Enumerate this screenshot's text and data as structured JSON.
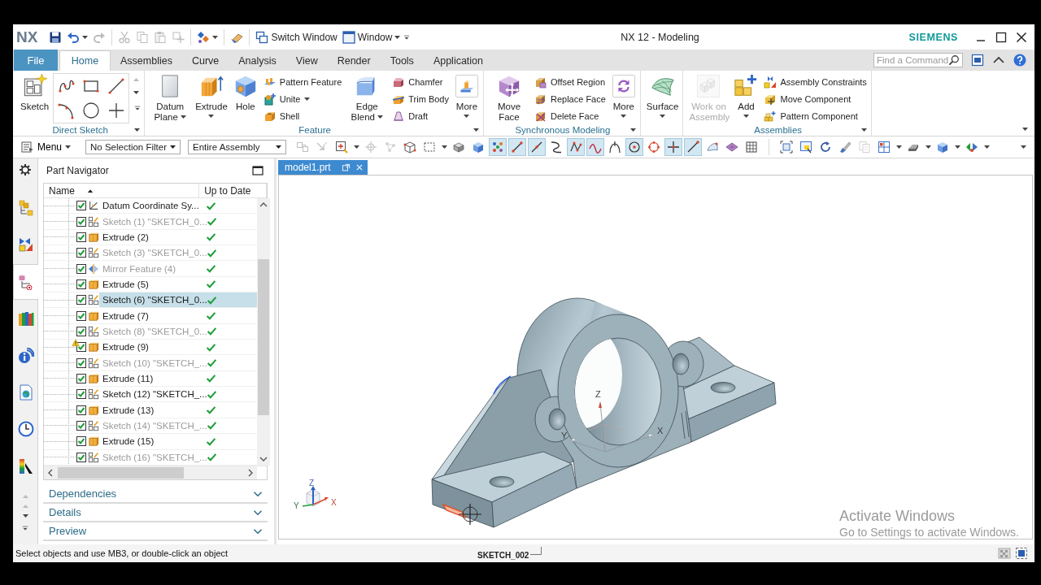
{
  "window": {
    "logo": "NX",
    "title": "NX 12 - Modeling",
    "brand": "SIEMENS"
  },
  "quick_access": {
    "tools": [
      {
        "disabled": false,
        "dropdown": false
      },
      {
        "disabled": false,
        "dropdown": true
      },
      {
        "disabled": true,
        "dropdown": false
      },
      {
        "disabled": true,
        "dropdown": false
      },
      {
        "disabled": true,
        "dropdown": false
      },
      {
        "disabled": true,
        "dropdown": false
      },
      {
        "disabled": true,
        "dropdown": false
      },
      {
        "disabled": false,
        "dropdown": true
      },
      {
        "disabled": false,
        "dropdown": false
      }
    ],
    "switch_window": "Switch Window",
    "window_menu": "Window"
  },
  "file_tab": "File",
  "tabs": [
    {
      "label": "Home",
      "selected": true
    },
    {
      "label": "Assemblies",
      "selected": false
    },
    {
      "label": "Curve",
      "selected": false
    },
    {
      "label": "Analysis",
      "selected": false
    },
    {
      "label": "View",
      "selected": false
    },
    {
      "label": "Render",
      "selected": false
    },
    {
      "label": "Tools",
      "selected": false
    },
    {
      "label": "Application",
      "selected": false
    }
  ],
  "command_search": {
    "placeholder": "Find a Command"
  },
  "ribbon": {
    "groups": [
      {
        "label": "Direct Sketch",
        "controls": [
          {
            "kind": "large",
            "label": "Sketch",
            "dropdown": false,
            "disabled": false
          },
          {
            "kind": "gallery"
          }
        ]
      },
      {
        "label": "Feature",
        "controls": [
          {
            "kind": "large",
            "label": "Datum Plane",
            "dropdown": true,
            "disabled": false
          },
          {
            "kind": "large",
            "label": "Extrude",
            "dropdown": true,
            "disabled": false
          },
          {
            "kind": "large",
            "label": "Hole",
            "dropdown": false,
            "disabled": false
          },
          {
            "kind": "stack",
            "items": [
              {
                "label": "Pattern Feature",
                "dropdown": false
              },
              {
                "label": "Unite",
                "dropdown": true
              },
              {
                "label": "Shell",
                "dropdown": false
              }
            ]
          },
          {
            "kind": "large",
            "label": "Edge Blend",
            "dropdown": true,
            "disabled": false
          },
          {
            "kind": "stack",
            "items": [
              {
                "label": "Chamfer",
                "dropdown": false
              },
              {
                "label": "Trim Body",
                "dropdown": false
              },
              {
                "label": "Draft",
                "dropdown": false
              }
            ]
          },
          {
            "kind": "large",
            "label": "More",
            "dropdown": true,
            "disabled": false
          }
        ]
      },
      {
        "label": "Synchronous Modeling",
        "controls": [
          {
            "kind": "large",
            "label": "Move Face",
            "dropdown": false,
            "disabled": false
          },
          {
            "kind": "stack",
            "items": [
              {
                "label": "Offset Region",
                "dropdown": false
              },
              {
                "label": "Replace Face",
                "dropdown": false
              },
              {
                "label": "Delete Face",
                "dropdown": false
              }
            ]
          },
          {
            "kind": "large",
            "label": "More",
            "dropdown": true,
            "disabled": false
          }
        ]
      },
      {
        "controls": [
          {
            "kind": "large",
            "label": "Surface",
            "dropdown": true,
            "disabled": false
          }
        ]
      },
      {
        "label": "Assemblies",
        "controls": [
          {
            "kind": "large",
            "label": "Work on Assembly",
            "dropdown": false,
            "disabled": true
          },
          {
            "kind": "large",
            "label": "Add",
            "dropdown": true,
            "disabled": false
          },
          {
            "kind": "stack",
            "items": [
              {
                "label": "Assembly Constraints",
                "dropdown": false
              },
              {
                "label": "Move Component",
                "dropdown": false
              },
              {
                "label": "Pattern Component",
                "dropdown": false
              }
            ]
          }
        ]
      }
    ]
  },
  "toolbar": {
    "menu": "Menu",
    "selection_filter": "No Selection Filter",
    "assembly_scope": "Entire Assembly",
    "tools": [
      {
        "on": false,
        "disabled": true,
        "dropdown": false
      },
      {
        "on": false,
        "disabled": true,
        "dropdown": false
      },
      {
        "on": false,
        "disabled": false,
        "dropdown": true
      },
      {
        "on": false,
        "disabled": true,
        "dropdown": false
      },
      {
        "on": false,
        "disabled": true,
        "dropdown": false
      },
      {
        "on": false,
        "disabled": false,
        "dropdown": false
      },
      {
        "on": false,
        "disabled": false,
        "dropdown": true
      },
      {
        "on": false,
        "disabled": false,
        "dropdown": false
      },
      {
        "on": false,
        "disabled": false,
        "dropdown": false
      },
      {
        "on": true,
        "disabled": false,
        "dropdown": false
      },
      {
        "on": true,
        "disabled": false,
        "dropdown": false
      },
      {
        "on": true,
        "disabled": false,
        "dropdown": false
      },
      {
        "on": false,
        "disabled": false,
        "dropdown": false
      },
      {
        "on": true,
        "disabled": false,
        "dropdown": false
      },
      {
        "on": true,
        "disabled": false,
        "dropdown": false
      },
      {
        "on": false,
        "disabled": false,
        "dropdown": false
      },
      {
        "on": true,
        "disabled": false,
        "dropdown": false
      },
      {
        "on": false,
        "disabled": false,
        "dropdown": false
      },
      {
        "on": true,
        "disabled": false,
        "dropdown": false
      },
      {
        "on": true,
        "disabled": false,
        "dropdown": false
      },
      {
        "on": false,
        "disabled": false,
        "dropdown": false
      },
      {
        "on": false,
        "disabled": false,
        "dropdown": false
      },
      {
        "on": false,
        "disabled": false,
        "dropdown": false
      },
      {
        "on": false,
        "disabled": false,
        "dropdown": false
      },
      {
        "on": false,
        "disabled": false,
        "dropdown": false
      },
      {
        "on": false,
        "disabled": false,
        "dropdown": false
      },
      {
        "on": false,
        "disabled": false,
        "dropdown": false
      },
      {
        "on": false,
        "disabled": true,
        "dropdown": false
      },
      {
        "on": false,
        "disabled": false,
        "dropdown": true
      },
      {
        "on": false,
        "disabled": false,
        "dropdown": true
      },
      {
        "on": false,
        "disabled": false,
        "dropdown": true
      },
      {
        "on": false,
        "disabled": false,
        "dropdown": true
      }
    ]
  },
  "resource_bar": [
    {
      "selected": false
    },
    {
      "selected": false
    },
    {
      "selected": true
    },
    {
      "selected": false
    },
    {
      "selected": false
    },
    {
      "selected": false
    },
    {
      "selected": false
    },
    {
      "selected": false
    }
  ],
  "part_navigator": {
    "title": "Part Navigator",
    "columns": [
      {
        "label": "Name",
        "sorted": true
      },
      {
        "label": "Up to Date",
        "sorted": false
      }
    ],
    "rows": [
      {
        "kind": "datum",
        "name": "Datum Coordinate Sy...",
        "checked": true,
        "dimmed": false,
        "warning": false,
        "selected": false,
        "up_to_date": true
      },
      {
        "kind": "sketch",
        "name": "Sketch (1) \"SKETCH_0...",
        "checked": true,
        "dimmed": true,
        "warning": false,
        "selected": false,
        "up_to_date": true
      },
      {
        "kind": "extrude",
        "name": "Extrude (2)",
        "checked": true,
        "dimmed": false,
        "warning": false,
        "selected": false,
        "up_to_date": true
      },
      {
        "kind": "sketch",
        "name": "Sketch (3) \"SKETCH_0...",
        "checked": true,
        "dimmed": true,
        "warning": false,
        "selected": false,
        "up_to_date": true
      },
      {
        "kind": "mirror",
        "name": "Mirror Feature (4)",
        "checked": true,
        "dimmed": true,
        "warning": false,
        "selected": false,
        "up_to_date": true
      },
      {
        "kind": "extrude",
        "name": "Extrude (5)",
        "checked": true,
        "dimmed": false,
        "warning": false,
        "selected": false,
        "up_to_date": true
      },
      {
        "kind": "sketch",
        "name": "Sketch (6) \"SKETCH_0...",
        "checked": true,
        "dimmed": false,
        "warning": false,
        "selected": true,
        "up_to_date": true
      },
      {
        "kind": "extrude",
        "name": "Extrude (7)",
        "checked": true,
        "dimmed": false,
        "warning": false,
        "selected": false,
        "up_to_date": true
      },
      {
        "kind": "sketch",
        "name": "Sketch (8) \"SKETCH_0...",
        "checked": true,
        "dimmed": true,
        "warning": false,
        "selected": false,
        "up_to_date": true
      },
      {
        "kind": "extrude",
        "name": "Extrude (9)",
        "checked": true,
        "dimmed": false,
        "warning": true,
        "selected": false,
        "up_to_date": true
      },
      {
        "kind": "sketch",
        "name": "Sketch (10) \"SKETCH_...",
        "checked": true,
        "dimmed": true,
        "warning": false,
        "selected": false,
        "up_to_date": true
      },
      {
        "kind": "extrude",
        "name": "Extrude (11)",
        "checked": true,
        "dimmed": false,
        "warning": false,
        "selected": false,
        "up_to_date": true
      },
      {
        "kind": "sketch",
        "name": "Sketch (12) \"SKETCH_...",
        "checked": true,
        "dimmed": false,
        "warning": false,
        "selected": false,
        "up_to_date": true
      },
      {
        "kind": "extrude",
        "name": "Extrude (13)",
        "checked": true,
        "dimmed": false,
        "warning": false,
        "selected": false,
        "up_to_date": true
      },
      {
        "kind": "sketch",
        "name": "Sketch (14) \"SKETCH_...",
        "checked": true,
        "dimmed": true,
        "warning": false,
        "selected": false,
        "up_to_date": true
      },
      {
        "kind": "extrude",
        "name": "Extrude (15)",
        "checked": true,
        "dimmed": false,
        "warning": false,
        "selected": false,
        "up_to_date": true
      },
      {
        "kind": "sketch",
        "name": "Sketch (16) \"SKETCH_...",
        "checked": true,
        "dimmed": true,
        "warning": false,
        "selected": false,
        "up_to_date": true
      }
    ],
    "panels": [
      {
        "label": "Dependencies",
        "expanded": false
      },
      {
        "label": "Details",
        "expanded": false
      },
      {
        "label": "Preview",
        "expanded": false
      }
    ]
  },
  "document_tabs": [
    {
      "label": "model1.prt",
      "selected": true
    }
  ],
  "viewport": {
    "wcs_axes": {
      "x": "X",
      "y": "Y",
      "z": "Z"
    },
    "view_triad_axes": {
      "x": "X",
      "y": "Y",
      "z": "Z"
    },
    "activation_notice": {
      "title": "Activate Windows",
      "message": "Go to Settings to activate Windows."
    }
  },
  "status_bar": {
    "message": "Select objects and use MB3, or double-click an object",
    "selection_label": "SKETCH_002"
  }
}
